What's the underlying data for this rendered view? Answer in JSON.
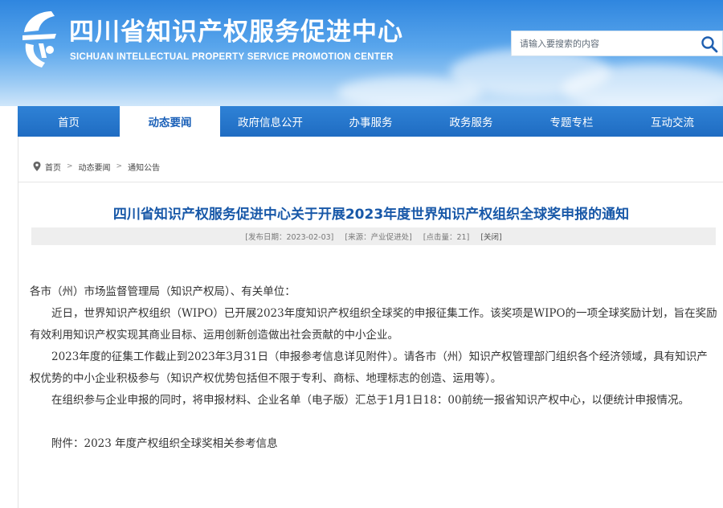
{
  "header": {
    "title": "四川省知识产权服务促进中心",
    "subtitle": "SICHUAN INTELLECTUAL PROPERTY SERVICE PROMOTION CENTER",
    "search_placeholder": "请输入要搜索的内容",
    "logo_icon": "sichuan-ip-logo-icon",
    "search_icon": "search-icon",
    "accent_color": "#1f6cc2"
  },
  "nav": {
    "items": [
      {
        "label": "首页"
      },
      {
        "label": "动态要闻",
        "active": true
      },
      {
        "label": "政府信息公开"
      },
      {
        "label": "办事服务"
      },
      {
        "label": "政务服务"
      },
      {
        "label": "专题专栏"
      },
      {
        "label": "互动交流"
      }
    ]
  },
  "breadcrumb": [
    "首页",
    "动态要闻",
    "通知公告"
  ],
  "article": {
    "title": "四川省知识产权服务促进中心关于开展2023年度世界知识产权组织全球奖申报的通知",
    "meta": {
      "date": "[发布日期：2023-02-03]",
      "source": "[来源：产业促进处]",
      "clicks": "[点击量：21]",
      "close": "[关闭]"
    },
    "paragraphs": [
      "各市（州）市场监督管理局（知识产权局）、有关单位：",
      "近日，世界知识产权组织（WIPO）已开展2023年度知识产权组织全球奖的申报征集工作。该奖项是WIPO的一项全球奖励计划，旨在奖励有效利用知识产权实现其商业目标、运用创新创造做出社会贡献的中小企业。",
      "2023年度的征集工作截止到2023年3月31日（申报参考信息详见附件）。请各市（州）知识产权管理部门组织各个经济领域，具有知识产权优势的中小企业积极参与（知识产权优势包括但不限于专利、商标、地理标志的创造、运用等）。",
      "在组织参与企业申报的同时，将申报材料、企业名单（电子版）汇总于1月1日18：00前统一报省知识产权中心，以便统计申报情况。"
    ],
    "attachment": "附件：2023 年度产权组织全球奖相关参考信息"
  }
}
